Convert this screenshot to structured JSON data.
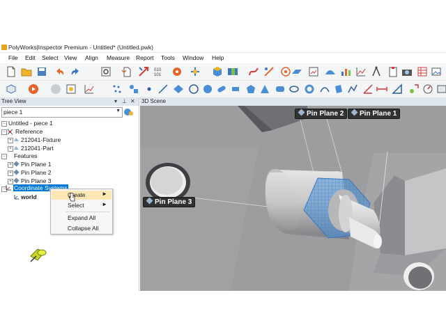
{
  "window": {
    "title": "PolyWorks|Inspector Premium - Untitled* (Untitled.pwk)"
  },
  "menu": [
    "File",
    "Edit",
    "Select",
    "View",
    "Align",
    "Measure",
    "Report",
    "Tools",
    "Window",
    "Help"
  ],
  "tree_view": {
    "title": "Tree View",
    "piece_select": "piece 1",
    "root": "Untitled - piece 1",
    "reference_label": "Reference",
    "reference_items": [
      "212041-Fixture",
      "212041-Part"
    ],
    "features_label": "Features",
    "feature_items": [
      "Pin Plane 1",
      "Pin Plane 2",
      "Pin Plane 3"
    ],
    "coordinate_systems_label": "Coordinate Systems",
    "world_label": "world"
  },
  "context_menu": {
    "items": [
      {
        "label": "Create",
        "has_submenu": true,
        "highlighted": true
      },
      {
        "label": "Select",
        "has_submenu": true
      },
      {
        "label": "Expand All"
      },
      {
        "label": "Collapse All"
      }
    ]
  },
  "scene": {
    "title": "3D Scene",
    "labels": [
      "Pin Plane 2",
      "Pin Plane 1",
      "Pin Plane 3"
    ]
  },
  "colors": {
    "panel_header": "#dfe6ee",
    "selection": "#0078d7",
    "mesh_highlight": "#4a8fd6",
    "scene_background": "#9c9d9f",
    "label_background": "#2f3133"
  }
}
